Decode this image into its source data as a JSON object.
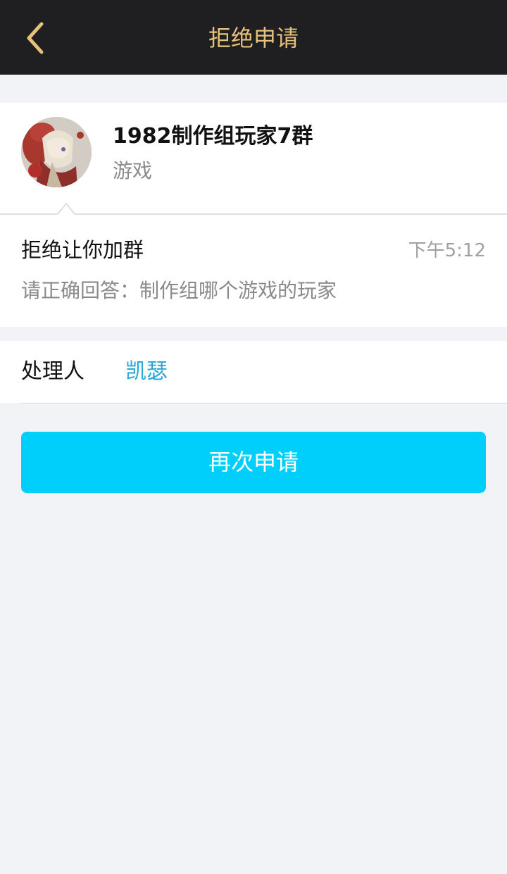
{
  "header": {
    "title": "拒绝申请",
    "back_icon": "chevron-left-icon",
    "accent_color": "#e7c178"
  },
  "group": {
    "name": "1982制作组玩家7群",
    "category": "游戏"
  },
  "reply": {
    "title": "拒绝让你加群",
    "time": "下午5:12",
    "message": "请正确回答：制作组哪个游戏的玩家"
  },
  "handler": {
    "label": "处理人",
    "name": "凯瑟",
    "name_color": "#27a7d8"
  },
  "actions": {
    "reapply_label": "再次申请",
    "reapply_color": "#00cffb"
  }
}
